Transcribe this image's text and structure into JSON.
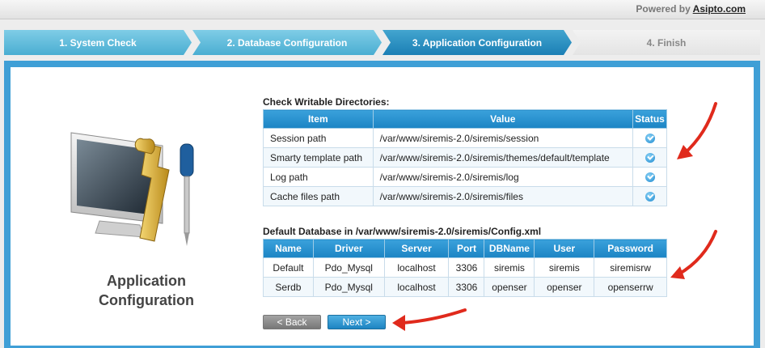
{
  "header": {
    "powered_prefix": "Powered by ",
    "powered_link": "Asipto.com"
  },
  "steps": [
    {
      "label": "1. System Check",
      "state": "done"
    },
    {
      "label": "2. Database Configuration",
      "state": "done"
    },
    {
      "label": "3. Application Configuration",
      "state": "active"
    },
    {
      "label": "4. Finish",
      "state": "todo"
    }
  ],
  "left": {
    "title_line1": "Application",
    "title_line2": "Configuration",
    "icon": "monitor-tools-icon"
  },
  "writable": {
    "title": "Check Writable Directories:",
    "headers": [
      "Item",
      "Value",
      "Status"
    ],
    "rows": [
      {
        "item": "Session path",
        "value": "/var/www/siremis-2.0/siremis/session",
        "status": "ok"
      },
      {
        "item": "Smarty template path",
        "value": "/var/www/siremis-2.0/siremis/themes/default/template",
        "status": "ok"
      },
      {
        "item": "Log path",
        "value": "/var/www/siremis-2.0/siremis/log",
        "status": "ok"
      },
      {
        "item": "Cache files path",
        "value": "/var/www/siremis-2.0/siremis/files",
        "status": "ok"
      }
    ]
  },
  "database": {
    "title": "Default Database in /var/www/siremis-2.0/siremis/Config.xml",
    "headers": [
      "Name",
      "Driver",
      "Server",
      "Port",
      "DBName",
      "User",
      "Password"
    ],
    "rows": [
      [
        "Default",
        "Pdo_Mysql",
        "localhost",
        "3306",
        "siremis",
        "siremis",
        "siremisrw"
      ],
      [
        "Serdb",
        "Pdo_Mysql",
        "localhost",
        "3306",
        "openser",
        "openser",
        "openserrw"
      ]
    ]
  },
  "buttons": {
    "back": "< Back",
    "next": "Next >"
  },
  "colors": {
    "accent": "#3f9fd6",
    "annotation": "#e02a1c"
  }
}
